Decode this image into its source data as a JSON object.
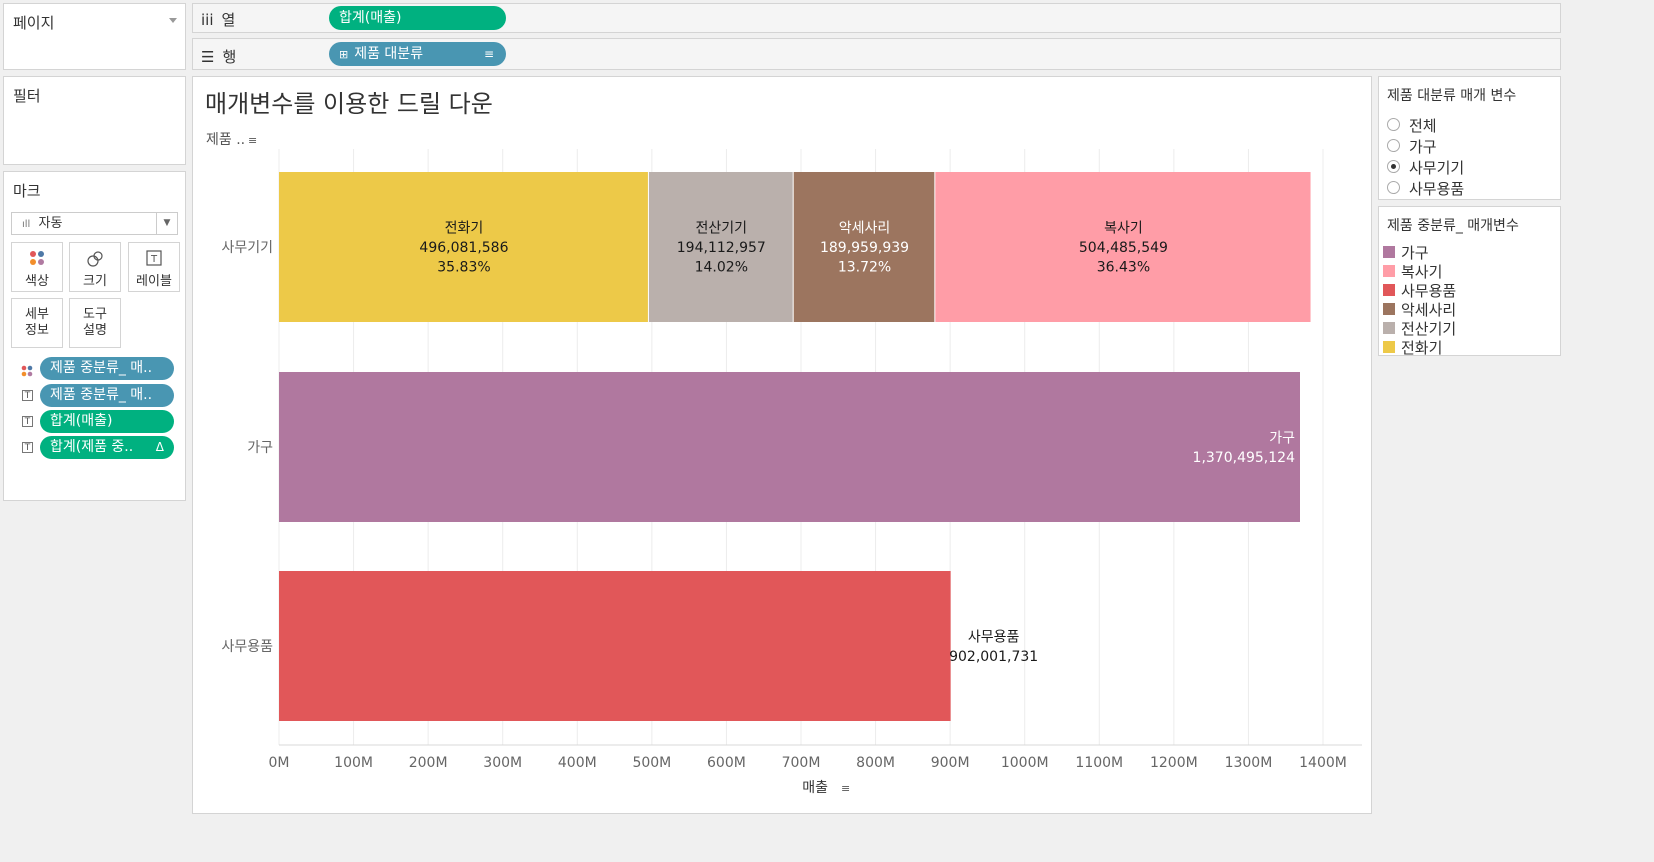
{
  "pages_shelf": {
    "label": "페이지"
  },
  "columns_shelf": {
    "icon": "iii",
    "label": "열",
    "pill": "합계(매출)"
  },
  "rows_shelf": {
    "label": "행",
    "pill": "제품 대분류"
  },
  "filters": {
    "label": "필터"
  },
  "marks": {
    "label": "마크",
    "type_select": "자동",
    "buttons": {
      "color": "색상",
      "size": "크기",
      "label": "레이블",
      "detail": "세부\n정보",
      "tooltip": "도구\n설명"
    },
    "fields": [
      {
        "icon": "color-icon",
        "text": "제품 중분류_ 매..",
        "kind": "dimension"
      },
      {
        "icon": "label-icon",
        "text": "제품 중분류_ 매..",
        "kind": "dimension"
      },
      {
        "icon": "label-icon",
        "text": "합계(매출)",
        "kind": "measure"
      },
      {
        "icon": "label-icon",
        "text": "합계(제품 중..",
        "kind": "measure",
        "badge": "Δ"
      }
    ]
  },
  "parameter": {
    "title": "제품 대분류 매개 변수",
    "options": [
      "전체",
      "가구",
      "사무기기",
      "사무용품"
    ],
    "selected": "사무기기"
  },
  "legend": {
    "title": "제품 중분류_ 매개변수",
    "items": [
      {
        "label": "가구",
        "color": "#b0789f"
      },
      {
        "label": "복사기",
        "color": "#ff9da7"
      },
      {
        "label": "사무용품",
        "color": "#e15759"
      },
      {
        "label": "악세사리",
        "color": "#9c755f"
      },
      {
        "label": "전산기기",
        "color": "#bab0ac"
      },
      {
        "label": "전화기",
        "color": "#edc948"
      }
    ]
  },
  "chart_data": {
    "type": "bar",
    "orientation": "horizontal",
    "stacked": true,
    "title": "매개변수를 이용한 드릴 다운",
    "row_header": "제품 ..",
    "xlabel": "매출",
    "xlim": [
      0,
      1450000000
    ],
    "xticks": [
      "0M",
      "100M",
      "200M",
      "300M",
      "400M",
      "500M",
      "600M",
      "700M",
      "800M",
      "900M",
      "1000M",
      "1100M",
      "1200M",
      "1300M",
      "1400M"
    ],
    "grid": true,
    "categories": [
      "사무기기",
      "가구",
      "사무용품"
    ],
    "bars": [
      {
        "category": "사무기기",
        "segments": [
          {
            "name": "전화기",
            "value": 496081586,
            "value_label": "496,081,586",
            "pct": "35.83%",
            "color": "#edc948",
            "text_color": "#1a1a1a"
          },
          {
            "name": "전산기기",
            "value": 194112957,
            "value_label": "194,112,957",
            "pct": "14.02%",
            "color": "#bab0ac",
            "text_color": "#1a1a1a"
          },
          {
            "name": "악세사리",
            "value": 189959939,
            "value_label": "189,959,939",
            "pct": "13.72%",
            "color": "#9c755f",
            "text_color": "#ffffff"
          },
          {
            "name": "복사기",
            "value": 504485549,
            "value_label": "504,485,549",
            "pct": "36.43%",
            "color": "#ff9da7",
            "text_color": "#1a1a1a"
          }
        ]
      },
      {
        "category": "가구",
        "segments": [
          {
            "name": "가구",
            "value": 1370495124,
            "value_label": "1,370,495,124",
            "color": "#b0789f",
            "text_color": "#ffffff",
            "label_position": "inside-end"
          }
        ]
      },
      {
        "category": "사무용품",
        "segments": [
          {
            "name": "사무용품",
            "value": 902001731,
            "value_label": "902,001,731",
            "color": "#e15759",
            "text_color": "#1a1a1a",
            "label_position": "outside-end"
          }
        ]
      }
    ]
  }
}
